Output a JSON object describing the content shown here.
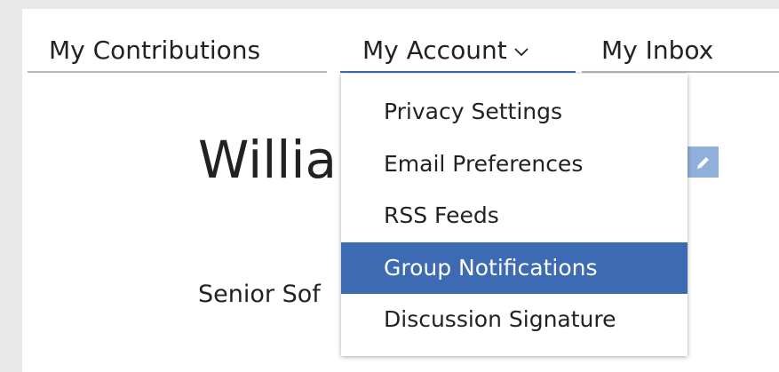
{
  "tabs": {
    "contributions": "My Contributions",
    "account": "My Account",
    "inbox": "My Inbox"
  },
  "account_menu": {
    "items": [
      {
        "label": "Privacy Settings",
        "active": false
      },
      {
        "label": "Email Preferences",
        "active": false
      },
      {
        "label": "RSS Feeds",
        "active": false
      },
      {
        "label": "Group Notifications",
        "active": true
      },
      {
        "label": "Discussion Signature",
        "active": false
      }
    ]
  },
  "profile": {
    "name": "Willia",
    "title": "Senior Sof"
  },
  "icons": {
    "chevron": "chevron-down-icon",
    "edit": "pencil-icon"
  },
  "colors": {
    "accent": "#3d6bb3",
    "edit_button": "#8fb0db",
    "tab_underline": "#b8b8b8",
    "background": "#e8e8e8"
  }
}
